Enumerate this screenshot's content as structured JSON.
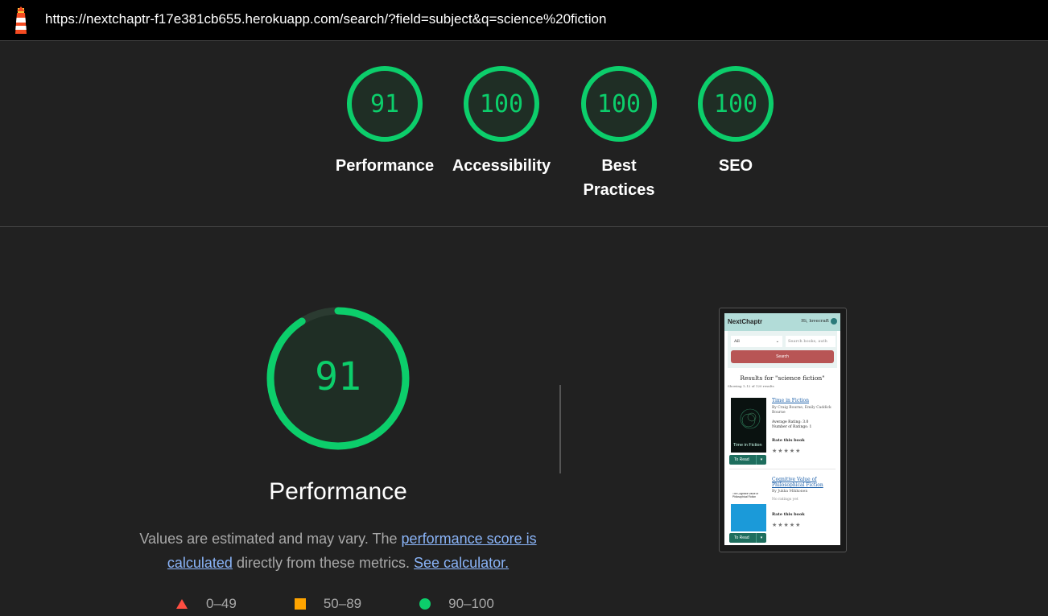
{
  "topbar": {
    "url": "https://nextchaptr-f17e381cb655.herokuapp.com/search/?field=subject&q=science%20fiction",
    "logo_icon": "lighthouse-icon"
  },
  "gauges": [
    {
      "score": "91",
      "label": "Performance"
    },
    {
      "score": "100",
      "label": "Accessibility"
    },
    {
      "score": "100",
      "label": "Best Practices"
    },
    {
      "score": "100",
      "label": "SEO"
    }
  ],
  "colors": {
    "pass": "#0cce6b",
    "pass_fill": "#1f2e25",
    "average": "#ffa400",
    "fail": "#ff4e42",
    "link": "#8ab4f8"
  },
  "performance": {
    "score": "91",
    "score_fraction": 0.91,
    "title": "Performance",
    "desc_prefix": "Values are estimated and may vary. The ",
    "desc_link": "performance score is calculated",
    "desc_middle": " directly from these metrics.",
    "desc_calc_link": "See calculator.",
    "legend": [
      {
        "range": "0–49",
        "icon": "red-triangle-icon"
      },
      {
        "range": "50–89",
        "icon": "orange-square-icon"
      },
      {
        "range": "90–100",
        "icon": "green-circle-icon"
      }
    ]
  },
  "thumbnail": {
    "brand": "NextChaptr",
    "user": "Hi, lovecraft",
    "select_value": "All",
    "search_placeholder": "Search books, auth",
    "search_button": "Search",
    "results_heading": "Results for \"science fiction\"",
    "showing": "Showing 1–12 of 120 results",
    "books": [
      {
        "title": "Time in Fiction",
        "authors": "By Craig Bourne, Emily Caddick Bourne",
        "rating": "Average Rating: 3.0",
        "count": "Number of Ratings: 1",
        "cover_text": "Time in Fiction",
        "rate_label": "Rate this book",
        "stars": "★★★★★",
        "to_read": "To Read"
      },
      {
        "title": "Cognitive Value of Philosophical Fiction",
        "authors": "By Jukka Mikkonen",
        "rating": "No ratings yet",
        "cover_text": "The Cognitive Value of Philosophical Fiction",
        "rate_label": "Rate this book",
        "stars": "★★★★★",
        "to_read": "To Read"
      }
    ]
  }
}
